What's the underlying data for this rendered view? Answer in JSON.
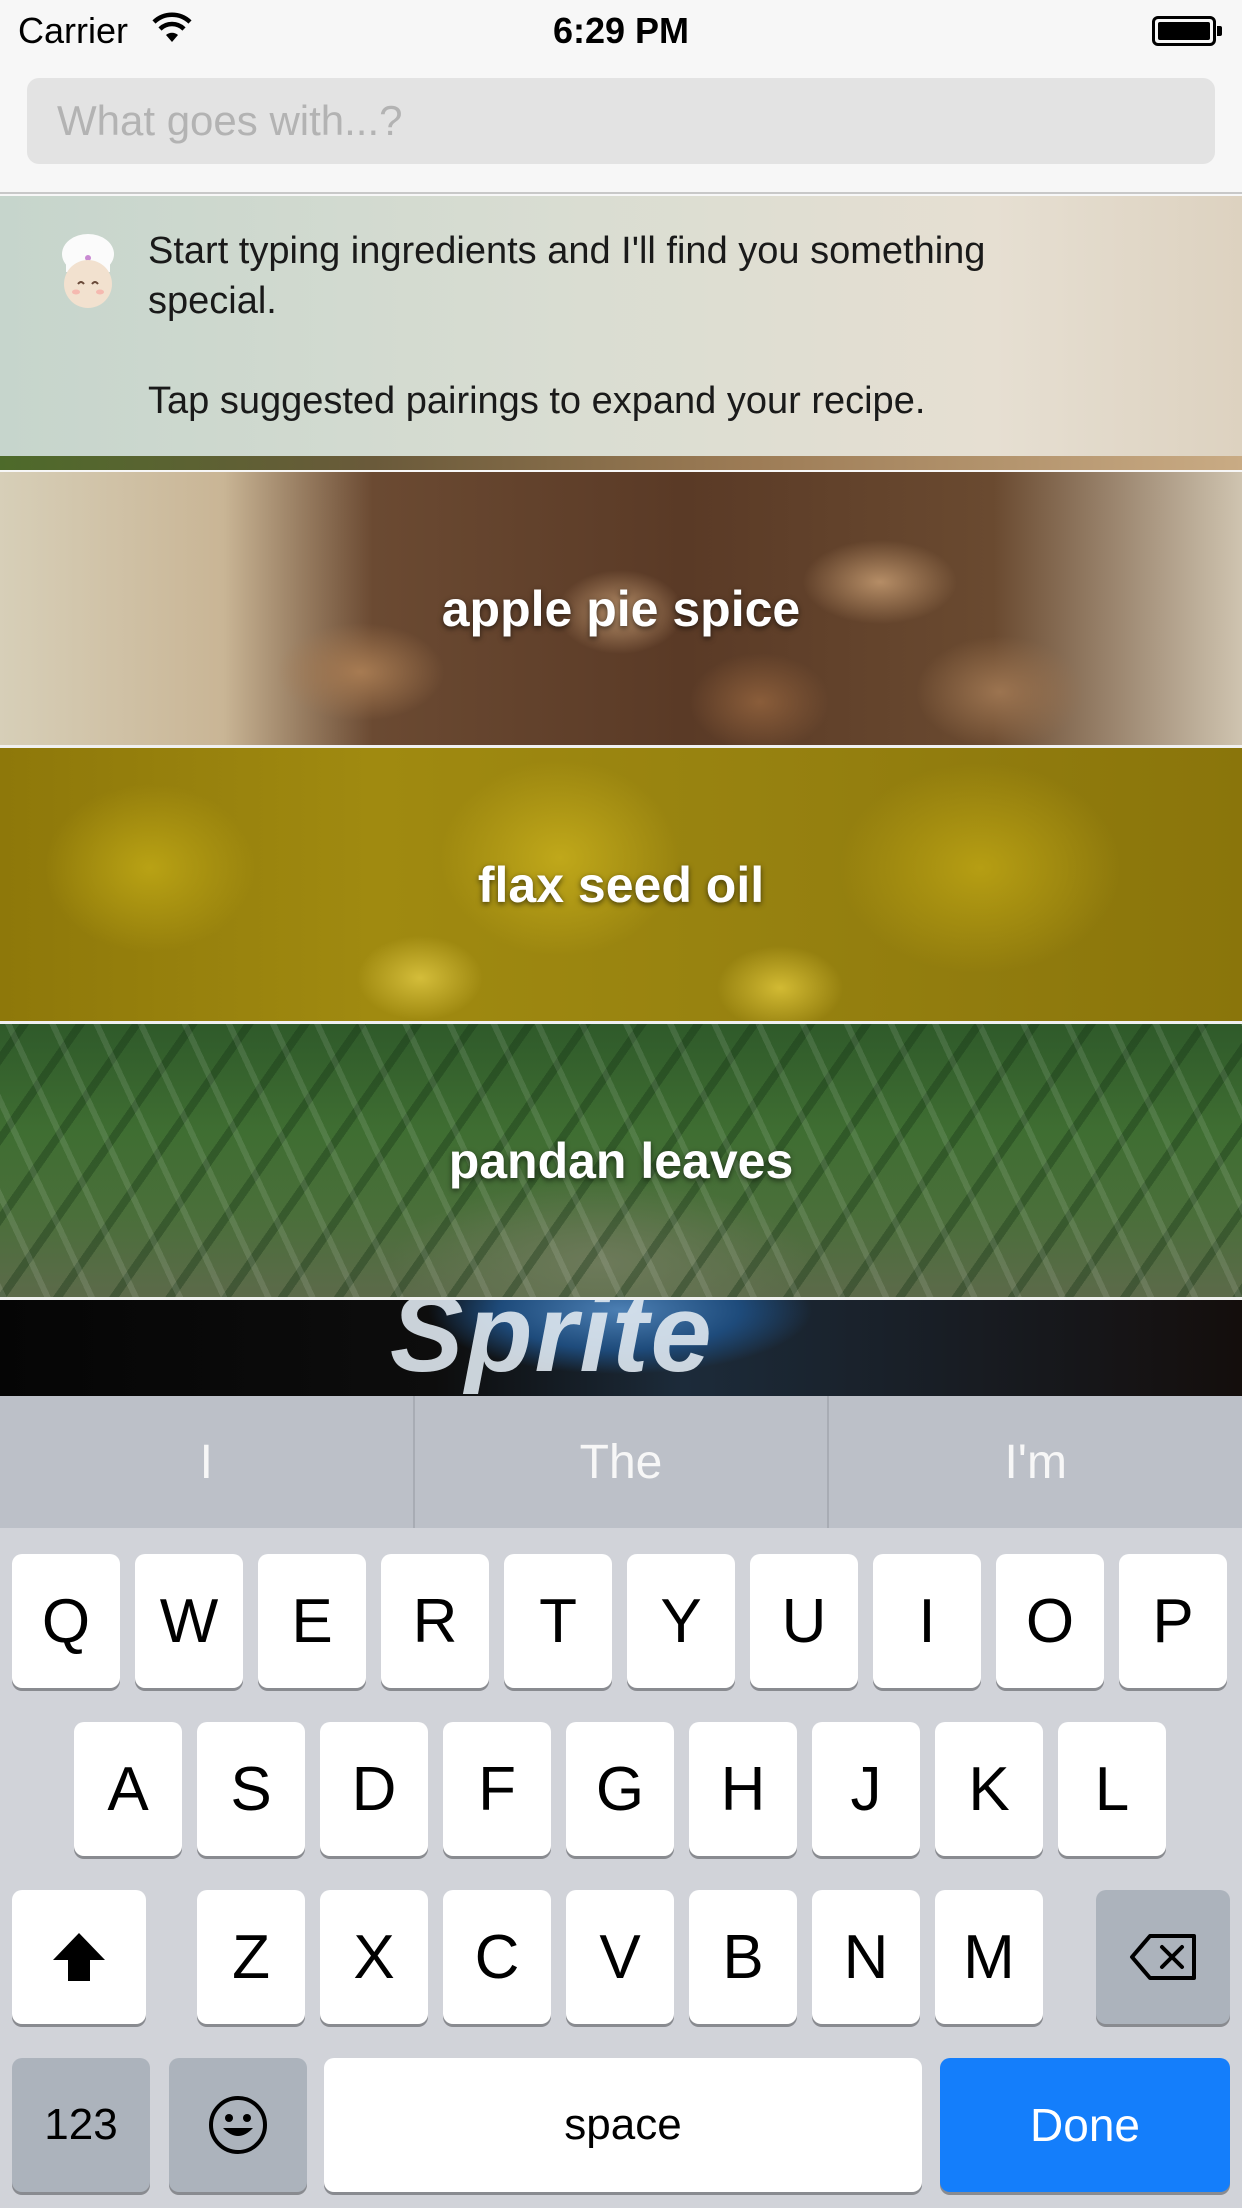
{
  "status_bar": {
    "carrier": "Carrier",
    "time": "6:29 PM"
  },
  "search": {
    "placeholder": "What goes with...?",
    "value": ""
  },
  "tip": {
    "line1": "Start typing ingredients and I'll find you something special.",
    "line2": "Tap suggested pairings to expand your recipe."
  },
  "pairings": [
    {
      "label": "apple pie spice"
    },
    {
      "label": "flax seed oil"
    },
    {
      "label": "pandan leaves"
    },
    {
      "label": ""
    }
  ],
  "sprite_image_text": "Sprite",
  "keyboard": {
    "predictions": [
      "I",
      "The",
      "I'm"
    ],
    "row1": [
      "Q",
      "W",
      "E",
      "R",
      "T",
      "Y",
      "U",
      "I",
      "O",
      "P"
    ],
    "row2": [
      "A",
      "S",
      "D",
      "F",
      "G",
      "H",
      "J",
      "K",
      "L"
    ],
    "row3": [
      "Z",
      "X",
      "C",
      "V",
      "B",
      "N",
      "M"
    ],
    "numbers_key": "123",
    "space_key": "space",
    "done_key": "Done",
    "done_color": "#147efb"
  }
}
